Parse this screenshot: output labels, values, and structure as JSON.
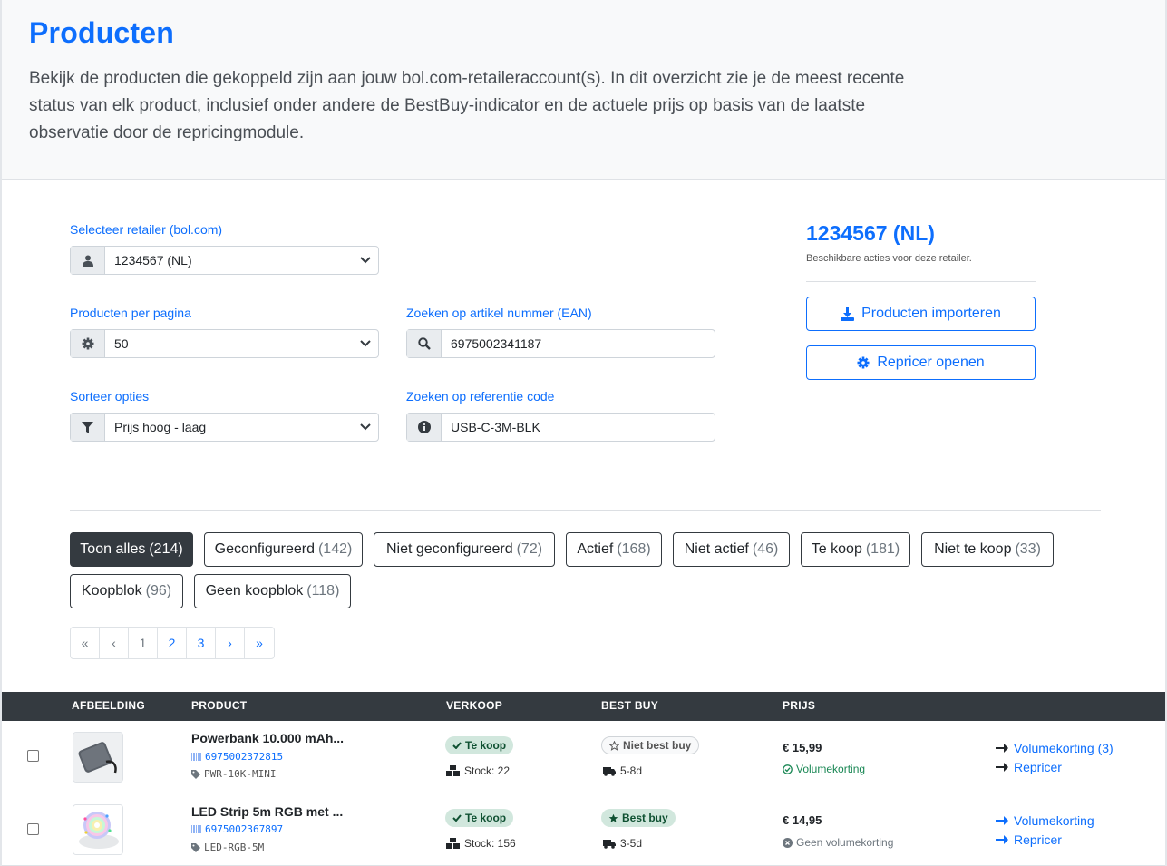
{
  "header": {
    "title": "Producten",
    "description": "Bekijk de producten die gekoppeld zijn aan jouw bol.com-retaileraccount(s). In dit overzicht zie je de meest recente status van elk product, inclusief onder andere de BestBuy-indicator en de actuele prijs op basis van de laatste observatie door de repricingmodule."
  },
  "form": {
    "retailer_label": "Selecteer retailer (bol.com)",
    "retailer_value": "1234567 (NL)",
    "per_page_label": "Producten per pagina",
    "per_page_value": "50",
    "ean_label": "Zoeken op artikel nummer (EAN)",
    "ean_value": "6975002341187",
    "sort_label": "Sorteer opties",
    "sort_value": "Prijs hoog - laag",
    "ref_label": "Zoeken op referentie code",
    "ref_value": "USB-C-3M-BLK"
  },
  "retailer_panel": {
    "title": "1234567 (NL)",
    "subtitle": "Beschikbare acties voor deze retailer.",
    "import_button": "Producten importeren",
    "repricer_button": "Repricer openen"
  },
  "filters": [
    {
      "label": "Toon alles",
      "count": "(214)",
      "active": true
    },
    {
      "label": "Geconfigureerd",
      "count": "(142)",
      "active": false
    },
    {
      "label": "Niet geconfigureerd",
      "count": "(72)",
      "active": false
    },
    {
      "label": "Actief",
      "count": "(168)",
      "active": false
    },
    {
      "label": "Niet actief",
      "count": "(46)",
      "active": false
    },
    {
      "label": "Te koop",
      "count": "(181)",
      "active": false
    },
    {
      "label": "Niet te koop",
      "count": "(33)",
      "active": false
    },
    {
      "label": "Koopblok",
      "count": "(96)",
      "active": false
    },
    {
      "label": "Geen koopblok",
      "count": "(118)",
      "active": false
    }
  ],
  "pagination": [
    "«",
    "‹",
    "1",
    "2",
    "3",
    "›",
    "»"
  ],
  "table": {
    "headers": [
      "AFBEELDING",
      "PRODUCT",
      "VERKOOP",
      "BEST BUY",
      "PRIJS"
    ],
    "rows": [
      {
        "name": "Powerbank 10.000 mAh...",
        "ean": "6975002372815",
        "ref": "PWR-10K-MINI",
        "sale_badge": "Te koop",
        "stock": "Stock: 22",
        "bestbuy_badge": "Niet best buy",
        "delivery": "5-8d",
        "price": "€ 15,99",
        "volume_status": "Volumekorting",
        "link1": "Volumekorting (3)",
        "link2": "Repricer"
      },
      {
        "name": "LED Strip 5m RGB met ...",
        "ean": "6975002367897",
        "ref": "LED-RGB-5M",
        "sale_badge": "Te koop",
        "stock": "Stock: 156",
        "bestbuy_badge": "Best buy",
        "delivery": "3-5d",
        "price": "€ 14,95",
        "volume_status": "Geen volumekorting",
        "link1": "Volumekorting",
        "link2": "Repricer"
      }
    ]
  },
  "colors": {
    "primary": "#0d6efd",
    "dark": "#343a40",
    "success": "#198754",
    "badge_green_bg": "#d1e7dd"
  }
}
